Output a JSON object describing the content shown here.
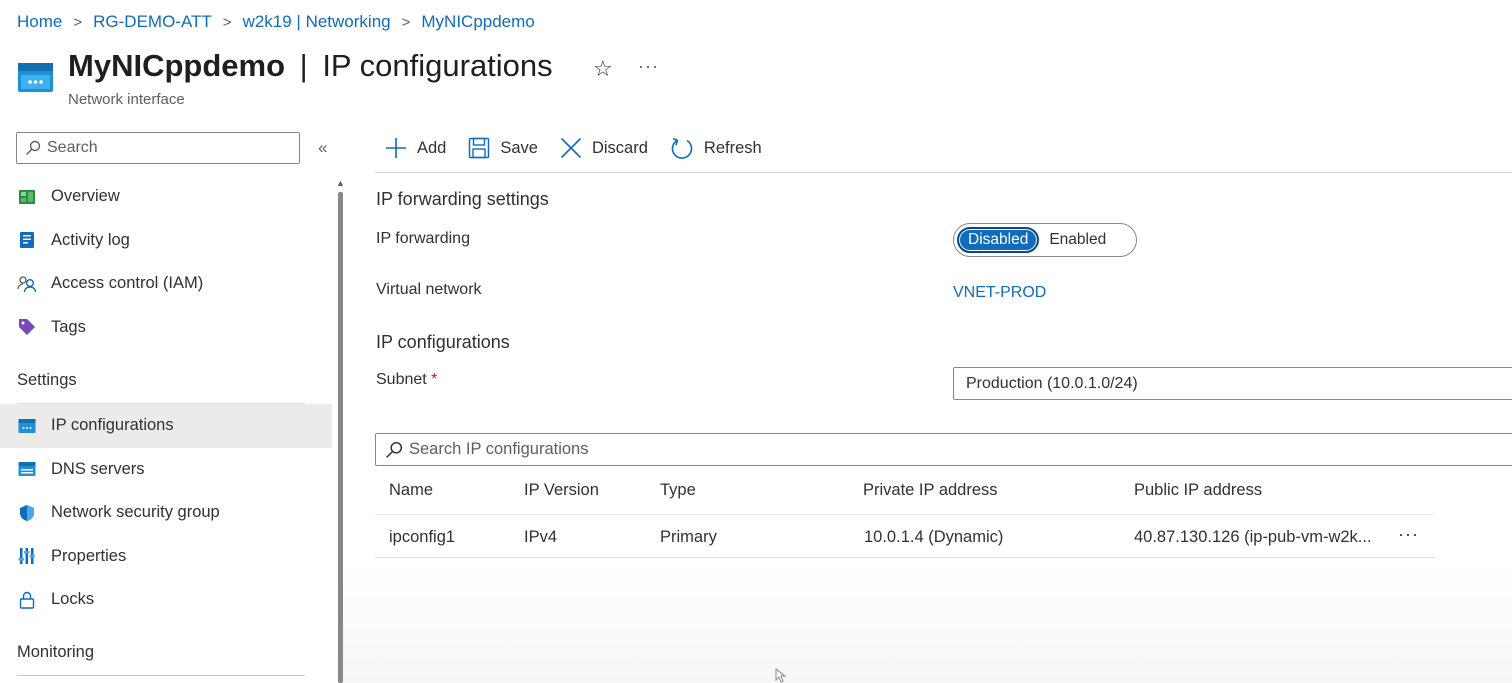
{
  "breadcrumb": [
    "Home",
    "RG-DEMO-ATT",
    "w2k19 | Networking",
    "MyNICppdemo"
  ],
  "header": {
    "resource_name": "MyNICppdemo",
    "separator": "|",
    "page_name": "IP configurations",
    "subtitle": "Network interface",
    "favorite_icon": "star-icon",
    "more_label": "···"
  },
  "sidebar": {
    "search_placeholder": "Search",
    "collapse_label": "«",
    "items": [
      {
        "label": "Overview",
        "icon": "overview-icon"
      },
      {
        "label": "Activity log",
        "icon": "activity-log-icon"
      },
      {
        "label": "Access control (IAM)",
        "icon": "people-icon"
      },
      {
        "label": "Tags",
        "icon": "tag-icon"
      }
    ],
    "settings_header": "Settings",
    "settings_items": [
      {
        "label": "IP configurations",
        "icon": "nic-icon",
        "active": true
      },
      {
        "label": "DNS servers",
        "icon": "dns-icon"
      },
      {
        "label": "Network security group",
        "icon": "shield-icon"
      },
      {
        "label": "Properties",
        "icon": "properties-icon"
      },
      {
        "label": "Locks",
        "icon": "lock-icon"
      }
    ],
    "monitoring_header": "Monitoring"
  },
  "toolbar": {
    "add_label": "Add",
    "save_label": "Save",
    "discard_label": "Discard",
    "refresh_label": "Refresh"
  },
  "forwarding": {
    "section_title": "IP forwarding settings",
    "ip_forwarding_label": "IP forwarding",
    "options": [
      "Disabled",
      "Enabled"
    ],
    "selected": "Disabled",
    "virtual_network_label": "Virtual network",
    "virtual_network_value": "VNET-PROD"
  },
  "ipconfig": {
    "section_title": "IP configurations",
    "subnet_label": "Subnet",
    "required_mark": "*",
    "subnet_value": "Production (10.0.1.0/24)",
    "search_placeholder": "Search IP configurations",
    "columns": [
      "Name",
      "IP Version",
      "Type",
      "Private IP address",
      "Public IP address"
    ],
    "rows": [
      [
        "ipconfig1",
        "IPv4",
        "Primary",
        "10.0.1.4 (Dynamic)",
        "40.87.130.126 (ip-pub-vm-w2k..."
      ]
    ],
    "row_more_label": "···"
  },
  "colors": {
    "accent": "#0f6cbd",
    "active_nav": "#edebe9"
  }
}
